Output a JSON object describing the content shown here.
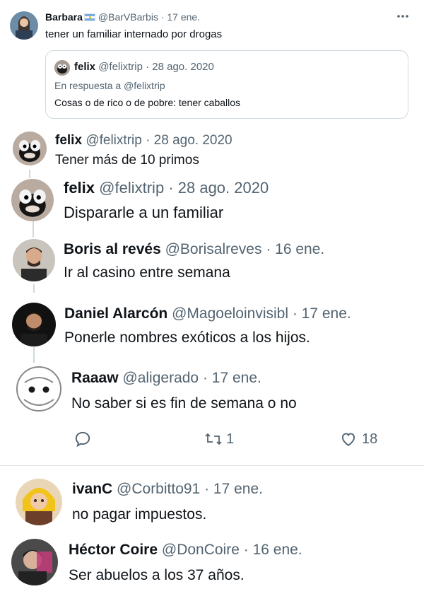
{
  "tweet_top": {
    "name": "Barbara",
    "handle": "@BarVBarbis",
    "time": "· 17 ene.",
    "text": "tener un familiar internado por drogas",
    "quote": {
      "name": "felix",
      "handle": "@felixtrip",
      "time": "· 28 ago. 2020",
      "reply_to": "En respuesta a @felixtrip",
      "text": "Cosas o de rico o de pobre: tener caballos"
    }
  },
  "replies": [
    {
      "name": "felix",
      "handle": "@felixtrip",
      "time": "· 28 ago. 2020",
      "text": "Tener más de 10 primos"
    },
    {
      "name": "felix",
      "handle": "@felixtrip",
      "time": "· 28 ago. 2020",
      "text": "Dispararle a un familiar"
    },
    {
      "name": "Boris al revés",
      "handle": "@Borisalreves",
      "time": "· 16 ene.",
      "text": "Ir al casino entre semana"
    },
    {
      "name": "Daniel Alarcón",
      "handle": "@Magoeloinvisibl",
      "time": "· 17 ene.",
      "text": "Ponerle nombres exóticos a los hijos."
    },
    {
      "name": "Raaaw",
      "handle": "@aligerado",
      "time": "· 17 ene.",
      "text": "No saber si es fin de semana o no"
    }
  ],
  "actions": {
    "reply_count": "",
    "retweet_count": "1",
    "like_count": "18"
  },
  "replies_bottom": [
    {
      "name": "ivanC",
      "handle": "@Corbitto91",
      "time": "· 17 ene.",
      "text": "no pagar impuestos."
    },
    {
      "name": "Héctor Coire",
      "handle": "@DonCoire",
      "time": "· 16 ene.",
      "text": "Ser abuelos a los 37 años."
    }
  ],
  "icons": [
    "ellipsis-icon",
    "argentina-flag-icon",
    "reply-icon",
    "retweet-icon",
    "like-icon"
  ],
  "colors": {
    "text": "#0f1419",
    "muted": "#536471",
    "border": "#cfd9de"
  }
}
